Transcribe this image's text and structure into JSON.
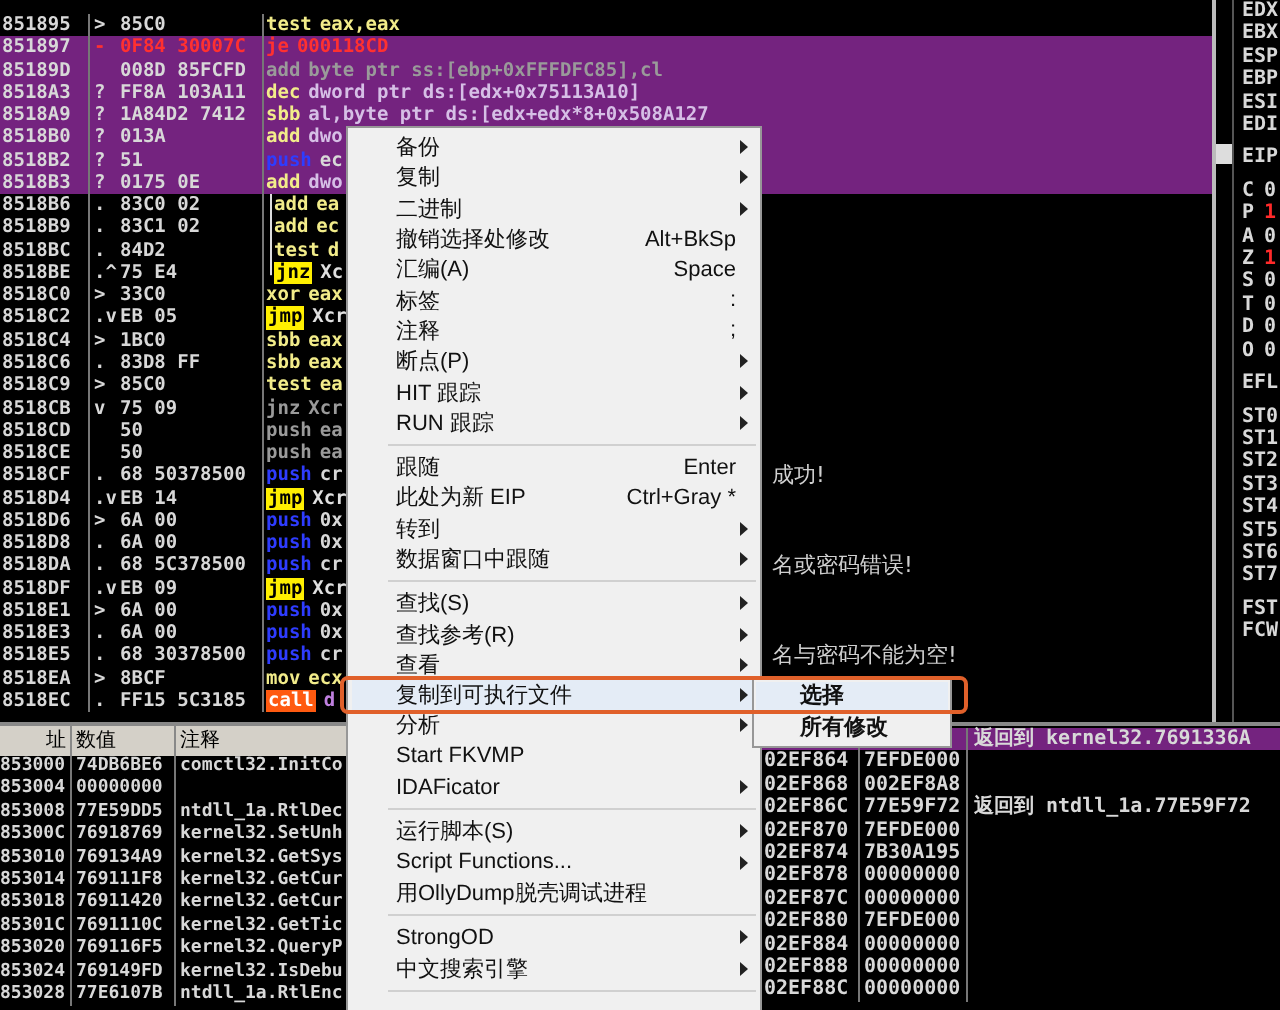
{
  "disassembly": {
    "rows": [
      {
        "address": "851895",
        "mark": ">",
        "hex": "85C0",
        "mnemonic": "test",
        "operands": "eax,eax",
        "kind": "arith",
        "selected": false
      },
      {
        "address": "851897",
        "mark": "-",
        "hex": "0F84 30007C",
        "mnemonic": "je",
        "operands": "000118CD",
        "kind": "cond",
        "selected": true
      },
      {
        "address": "85189D",
        "mark": "",
        "hex": "008D 85FCFD",
        "mnemonic": "add",
        "operands": "byte ptr ss:[ebp+0xFFFDFC85],cl",
        "kind": "dim",
        "selected": true
      },
      {
        "address": "8518A3",
        "mark": "?",
        "hex": "FF8A 103A11",
        "mnemonic": "dec",
        "operands": "dword ptr ds:[edx+0x75113A10]",
        "kind": "arith",
        "selected": true
      },
      {
        "address": "8518A9",
        "mark": "?",
        "hex": "1A84D2 7412",
        "mnemonic": "sbb",
        "operands": "al,byte ptr ds:[edx+edx*8+0x508A127",
        "kind": "arith",
        "selected": true
      },
      {
        "address": "8518B0",
        "mark": "?",
        "hex": "013A",
        "mnemonic": "add",
        "operands": "dwo",
        "kind": "arith",
        "selected": true
      },
      {
        "address": "8518B2",
        "mark": "?",
        "hex": "51",
        "mnemonic": "push",
        "operands": "ec",
        "kind": "push",
        "selected": true
      },
      {
        "address": "8518B3",
        "mark": "?",
        "hex": "0175 0E",
        "mnemonic": "add",
        "operands": "dwo",
        "kind": "arith",
        "selected": true
      },
      {
        "address": "8518B6",
        "mark": ".",
        "hex": "83C0 02",
        "mnemonic": "add",
        "operands": "ea",
        "kind": "arith",
        "selected": false,
        "in_loop": true,
        "loop_end": false
      },
      {
        "address": "8518B9",
        "mark": ".",
        "hex": "83C1 02",
        "mnemonic": "add",
        "operands": "ec",
        "kind": "arith",
        "selected": false,
        "in_loop": true,
        "loop_end": false
      },
      {
        "address": "8518BC",
        "mark": ".",
        "hex": "84D2",
        "mnemonic": "test",
        "operands": "d",
        "kind": "arith",
        "selected": false,
        "in_loop": true,
        "loop_end": false
      },
      {
        "address": "8518BE",
        "mark": ".^",
        "hex": "75 E4",
        "mnemonic": "jnz",
        "operands": "Xc",
        "kind": "jump",
        "selected": false,
        "in_loop": true,
        "loop_end": true
      },
      {
        "address": "8518C0",
        "mark": ">",
        "hex": "33C0",
        "mnemonic": "xor",
        "operands": "eax",
        "kind": "arith",
        "selected": false
      },
      {
        "address": "8518C2",
        "mark": ".v",
        "hex": "EB 05",
        "mnemonic": "jmp",
        "operands": "Xcr",
        "kind": "jump",
        "selected": false
      },
      {
        "address": "8518C4",
        "mark": ">",
        "hex": "1BC0",
        "mnemonic": "sbb",
        "operands": "eax",
        "kind": "arith",
        "selected": false
      },
      {
        "address": "8518C6",
        "mark": ".",
        "hex": "83D8 FF",
        "mnemonic": "sbb",
        "operands": "eax",
        "kind": "arith",
        "selected": false
      },
      {
        "address": "8518C9",
        "mark": ">",
        "hex": "85C0",
        "mnemonic": "test",
        "operands": "ea",
        "kind": "arith",
        "selected": false
      },
      {
        "address": "8518CB",
        "mark": "v",
        "hex": "75 09",
        "mnemonic": "jnz",
        "operands": "Xcr",
        "kind": "dim",
        "selected": false
      },
      {
        "address": "8518CD",
        "mark": "",
        "hex": "50",
        "mnemonic": "push",
        "operands": "ea",
        "kind": "dim",
        "selected": false
      },
      {
        "address": "8518CE",
        "mark": "",
        "hex": "50",
        "mnemonic": "push",
        "operands": "ea",
        "kind": "dim",
        "selected": false
      },
      {
        "address": "8518CF",
        "mark": ".",
        "hex": "68 50378500",
        "mnemonic": "push",
        "operands": "cr",
        "kind": "push",
        "selected": false,
        "tail": "成功!"
      },
      {
        "address": "8518D4",
        "mark": ".v",
        "hex": "EB 14",
        "mnemonic": "jmp",
        "operands": "Xcr",
        "kind": "jump",
        "selected": false
      },
      {
        "address": "8518D6",
        "mark": ">",
        "hex": "6A 00",
        "mnemonic": "push",
        "operands": "0x",
        "kind": "push",
        "selected": false
      },
      {
        "address": "8518D8",
        "mark": ".",
        "hex": "6A 00",
        "mnemonic": "push",
        "operands": "0x",
        "kind": "push",
        "selected": false
      },
      {
        "address": "8518DA",
        "mark": ".",
        "hex": "68 5C378500",
        "mnemonic": "push",
        "operands": "cr",
        "kind": "push",
        "selected": false,
        "tail": "名或密码错误!"
      },
      {
        "address": "8518DF",
        "mark": ".v",
        "hex": "EB 09",
        "mnemonic": "jmp",
        "operands": "Xcr",
        "kind": "jump",
        "selected": false
      },
      {
        "address": "8518E1",
        "mark": ">",
        "hex": "6A 00",
        "mnemonic": "push",
        "operands": "0x",
        "kind": "push",
        "selected": false
      },
      {
        "address": "8518E3",
        "mark": ".",
        "hex": "6A 00",
        "mnemonic": "push",
        "operands": "0x",
        "kind": "push",
        "selected": false
      },
      {
        "address": "8518E5",
        "mark": ".",
        "hex": "68 30378500",
        "mnemonic": "push",
        "operands": "cr",
        "kind": "push",
        "selected": false,
        "tail": "名与密码不能为空!"
      },
      {
        "address": "8518EA",
        "mark": ">",
        "hex": "8BCF",
        "mnemonic": "mov",
        "operands": "ecx",
        "kind": "arith",
        "selected": false
      },
      {
        "address": "8518EC",
        "mark": ".",
        "hex": "FF15 5C3185",
        "mnemonic": "call",
        "operands": "d",
        "kind": "call",
        "selected": false
      }
    ]
  },
  "registers": {
    "groups": [
      {
        "items": [
          {
            "name": "EDX"
          },
          {
            "name": "EBX"
          },
          {
            "name": "ESP"
          },
          {
            "name": "EBP"
          },
          {
            "name": "ESI"
          },
          {
            "name": "EDI"
          }
        ]
      },
      {
        "items": [
          {
            "name": "EIP"
          }
        ]
      },
      {
        "items": [
          {
            "name": "C",
            "value": "0",
            "changed": false
          },
          {
            "name": "P",
            "value": "1",
            "changed": true
          },
          {
            "name": "A",
            "value": "0",
            "changed": false
          },
          {
            "name": "Z",
            "value": "1",
            "changed": true
          },
          {
            "name": "S",
            "value": "0",
            "changed": false
          },
          {
            "name": "T",
            "value": "0",
            "changed": false
          },
          {
            "name": "D",
            "value": "0",
            "changed": false
          },
          {
            "name": "O",
            "value": "0",
            "changed": false
          }
        ]
      },
      {
        "items": [
          {
            "name": "EFL"
          }
        ]
      },
      {
        "items": [
          {
            "name": "ST0"
          },
          {
            "name": "ST1"
          },
          {
            "name": "ST2"
          },
          {
            "name": "ST3"
          },
          {
            "name": "ST4"
          },
          {
            "name": "ST5"
          },
          {
            "name": "ST6"
          },
          {
            "name": "ST7"
          }
        ]
      },
      {
        "items": [
          {
            "name": "FST"
          },
          {
            "name": "FCW"
          }
        ]
      }
    ]
  },
  "memory_dump": {
    "columns": [
      "址",
      "数值",
      "注释"
    ],
    "rows": [
      {
        "address": "853000",
        "value": "74DB6BE6",
        "comment": "comctl32.InitCo"
      },
      {
        "address": "853004",
        "value": "00000000"
      },
      {
        "address": "853008",
        "value": "77E59DD5",
        "comment": "ntdll_1a.RtlDec"
      },
      {
        "address": "85300C",
        "value": "76918769",
        "comment": "kernel32.SetUnh"
      },
      {
        "address": "853010",
        "value": "769134A9",
        "comment": "kernel32.GetSys"
      },
      {
        "address": "853014",
        "value": "769111F8",
        "comment": "kernel32.GetCur"
      },
      {
        "address": "853018",
        "value": "76911420",
        "comment": "kernel32.GetCur"
      },
      {
        "address": "85301C",
        "value": "7691110C",
        "comment": "kernel32.GetTic"
      },
      {
        "address": "853020",
        "value": "769116F5",
        "comment": "kernel32.QueryP"
      },
      {
        "address": "853024",
        "value": "769149FD",
        "comment": "kernel32.IsDebu"
      },
      {
        "address": "853028",
        "value": "77E6107B",
        "comment": "ntdll_1a.RtlEnc"
      }
    ]
  },
  "stack": {
    "rows": [
      {
        "comment": "返回到 kernel32.7691336A",
        "selected": true
      },
      {
        "address": "02EF864",
        "value": "7EFDE000",
        "selected": false
      },
      {
        "address": "02EF868",
        "value": "002EF8A8",
        "selected": false
      },
      {
        "address": "02EF86C",
        "value": "77E59F72",
        "comment": "返回到 ntdll_1a.77E59F72",
        "selected": false
      },
      {
        "address": "02EF870",
        "value": "7EFDE000",
        "selected": false
      },
      {
        "address": "02EF874",
        "value": "7B30A195",
        "selected": false
      },
      {
        "address": "02EF878",
        "value": "00000000",
        "selected": false
      },
      {
        "address": "02EF87C",
        "value": "00000000",
        "selected": false
      },
      {
        "address": "02EF880",
        "value": "7EFDE000",
        "selected": false
      },
      {
        "address": "02EF884",
        "value": "00000000",
        "selected": false
      },
      {
        "address": "02EF888",
        "value": "00000000",
        "selected": false
      },
      {
        "address": "02EF88C",
        "value": "00000000",
        "selected": false
      }
    ]
  },
  "context_menu": {
    "items": [
      {
        "kind": "item",
        "label": "备份",
        "submenu": true,
        "selected": false
      },
      {
        "kind": "item",
        "label": "复制",
        "submenu": true,
        "selected": false
      },
      {
        "kind": "item",
        "label": "二进制",
        "submenu": true,
        "selected": false
      },
      {
        "kind": "item",
        "label": "撤销选择处修改",
        "shortcut": "Alt+BkSp",
        "submenu": false,
        "selected": false
      },
      {
        "kind": "item",
        "label": "汇编(A)",
        "shortcut": "Space",
        "submenu": false,
        "selected": false
      },
      {
        "kind": "item",
        "label": "标签",
        "shortcut": ":",
        "submenu": false,
        "selected": false
      },
      {
        "kind": "item",
        "label": "注释",
        "shortcut": ";",
        "submenu": false,
        "selected": false
      },
      {
        "kind": "item",
        "label": "断点(P)",
        "submenu": true,
        "selected": false
      },
      {
        "kind": "item",
        "label": "HIT 跟踪",
        "submenu": true,
        "selected": false
      },
      {
        "kind": "item",
        "label": "RUN 跟踪",
        "submenu": true,
        "selected": false
      },
      {
        "kind": "separator"
      },
      {
        "kind": "item",
        "label": "跟随",
        "shortcut": "Enter",
        "submenu": false,
        "selected": false
      },
      {
        "kind": "item",
        "label": "此处为新 EIP",
        "shortcut": "Ctrl+Gray *",
        "submenu": false,
        "selected": false
      },
      {
        "kind": "item",
        "label": "转到",
        "submenu": true,
        "selected": false
      },
      {
        "kind": "item",
        "label": "数据窗口中跟随",
        "submenu": true,
        "selected": false
      },
      {
        "kind": "separator"
      },
      {
        "kind": "item",
        "label": "查找(S)",
        "submenu": true,
        "selected": false
      },
      {
        "kind": "item",
        "label": "查找参考(R)",
        "submenu": true,
        "selected": false
      },
      {
        "kind": "item",
        "label": "查看",
        "submenu": true,
        "selected": false
      },
      {
        "kind": "item",
        "label": "复制到可执行文件",
        "submenu": true,
        "selected": true
      },
      {
        "kind": "item",
        "label": "分析",
        "submenu": true,
        "selected": false
      },
      {
        "kind": "item",
        "label": "Start FKVMP",
        "submenu": false,
        "selected": false
      },
      {
        "kind": "item",
        "label": "IDAFicator",
        "submenu": true,
        "selected": false
      },
      {
        "kind": "separator"
      },
      {
        "kind": "item",
        "label": "运行脚本(S)",
        "submenu": true,
        "selected": false
      },
      {
        "kind": "item",
        "label": "Script Functions...",
        "submenu": true,
        "selected": false
      },
      {
        "kind": "item",
        "label": "用OllyDump脱壳调试进程",
        "submenu": false,
        "selected": false
      },
      {
        "kind": "separator"
      },
      {
        "kind": "item",
        "label": "StrongOD",
        "submenu": true,
        "selected": false
      },
      {
        "kind": "item",
        "label": "中文搜索引擎",
        "submenu": true,
        "selected": false
      },
      {
        "kind": "separator"
      }
    ]
  },
  "submenu": {
    "items": [
      {
        "label": "选择",
        "selected": true
      },
      {
        "label": "所有修改",
        "selected": false
      }
    ]
  }
}
